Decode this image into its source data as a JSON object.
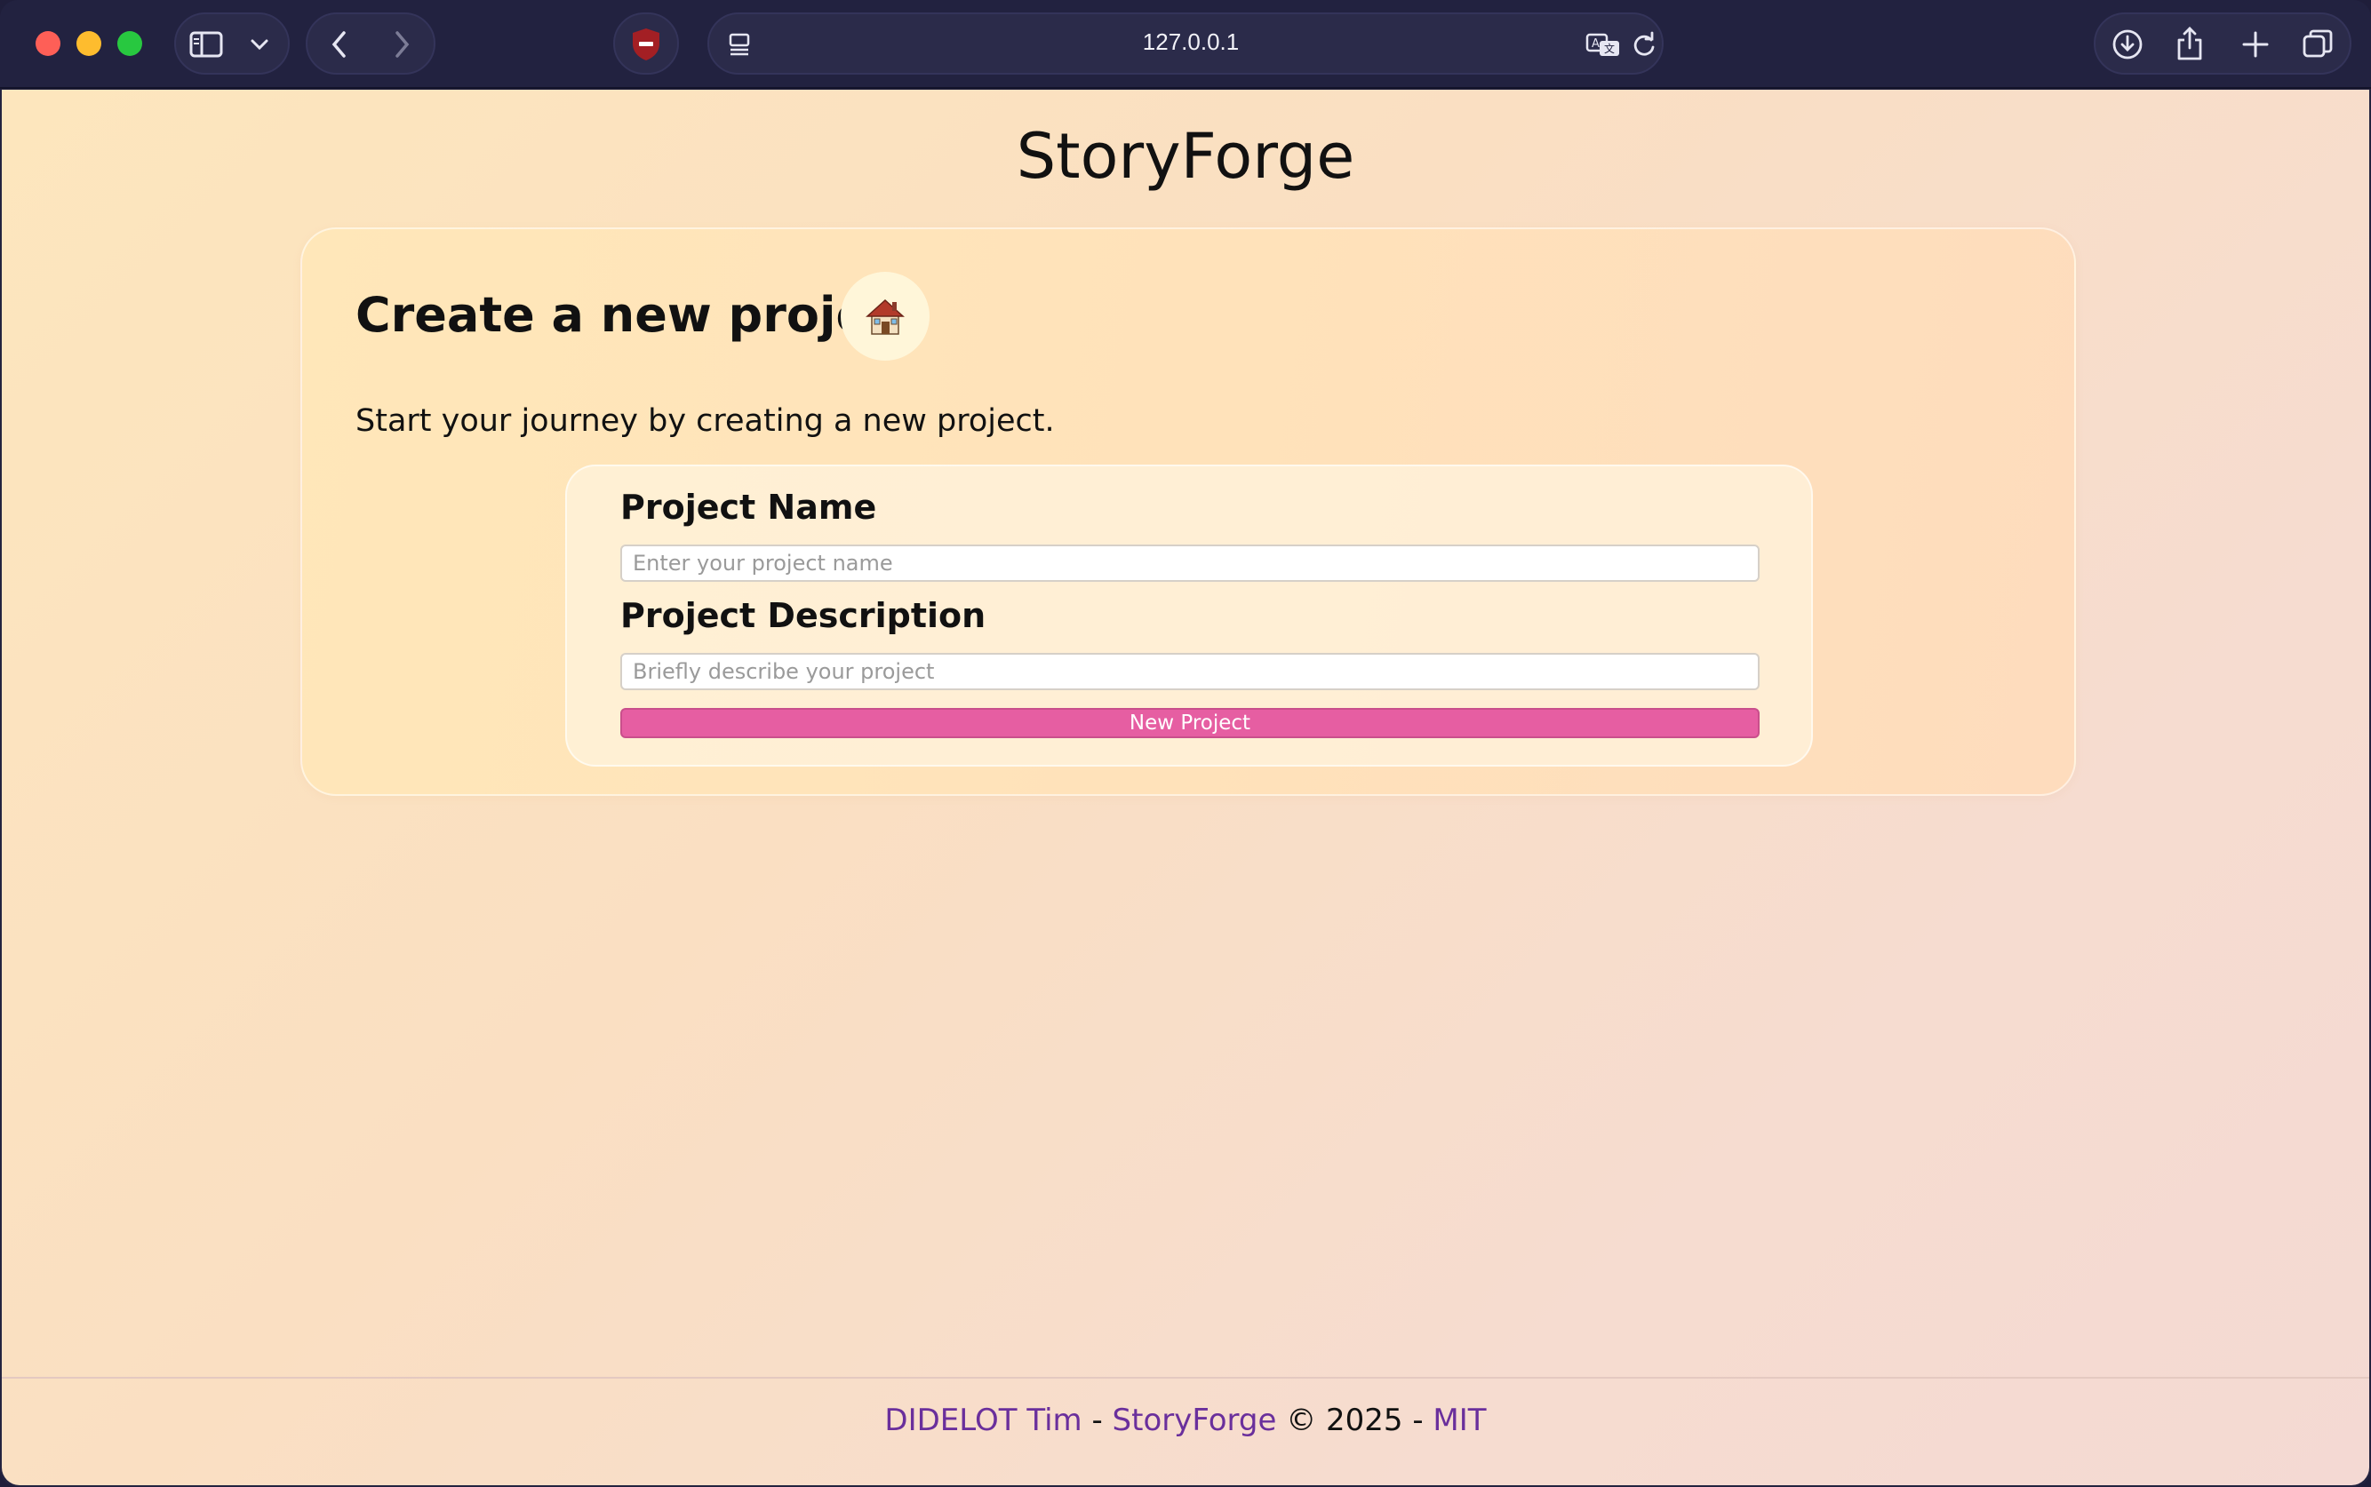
{
  "browser": {
    "url": "127.0.0.1"
  },
  "page": {
    "site_title": "StoryForge",
    "card": {
      "title": "Create a new project",
      "icon": "house-icon",
      "description": "Start your journey by creating a new project."
    },
    "form": {
      "name_label": "Project Name",
      "name_placeholder": "Enter your project name",
      "name_value": "",
      "description_label": "Project Description",
      "description_placeholder": "Briefly describe your project",
      "description_value": "",
      "submit_label": "New Project"
    }
  },
  "footer": {
    "author": "DIDELOT Tim",
    "sep1": " - ",
    "project": "StoryForge",
    "copyright": " © 2025 - ",
    "license": "MIT"
  },
  "colors": {
    "accent_button": "#e65ea2",
    "footer_link": "#6a2f9c",
    "toolbar": "#222240"
  }
}
